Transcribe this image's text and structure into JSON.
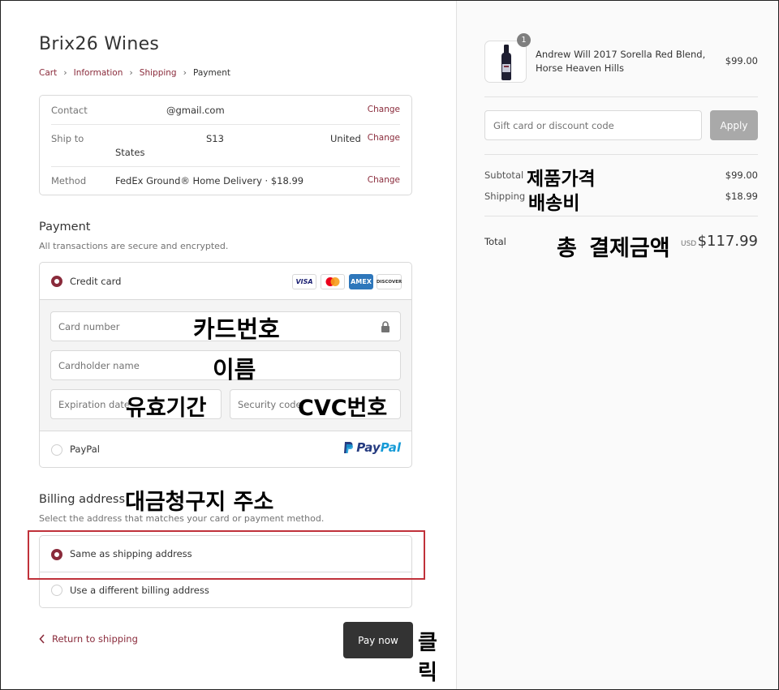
{
  "store": {
    "name": "Brix26 Wines"
  },
  "breadcrumb": {
    "cart": "Cart",
    "information": "Information",
    "shipping": "Shipping",
    "payment": "Payment",
    "separator": "›"
  },
  "review": {
    "contact_label": "Contact",
    "contact_value": "@gmail.com",
    "ship_label": "Ship to",
    "ship_value_mid": "S13",
    "ship_value_country": "United",
    "ship_value_states": "States",
    "method_label": "Method",
    "method_value": "FedEx Ground® Home Delivery · $18.99",
    "change_label": "Change"
  },
  "payment": {
    "title": "Payment",
    "subtitle": "All transactions are secure and encrypted.",
    "credit_card_label": "Credit card",
    "card_logos": {
      "visa": "VISA",
      "amex": "AMEX",
      "discover": "DISCOVER"
    },
    "card_number_placeholder": "Card number",
    "cardholder_placeholder": "Cardholder name",
    "expiration_placeholder": "Expiration date",
    "security_placeholder": "Security code",
    "paypal_label": "PayPal",
    "paypal_logo_pay": "Pay",
    "paypal_logo_pal": "Pal"
  },
  "billing": {
    "title": "Billing address",
    "subtitle": "Select the address that matches your card or payment method.",
    "same_label": "Same as shipping address",
    "different_label": "Use a different billing address"
  },
  "actions": {
    "return_label": "Return to shipping",
    "pay_now": "Pay now"
  },
  "annotations": {
    "card_number": "카드번호",
    "name": "이름",
    "expiry": "유효기간",
    "cvc": "CVC번호",
    "billing": "대금청구지 주소",
    "click": "클릭",
    "product_price": "제품가격",
    "shipping_fee": "배송비",
    "total": "총 결제금액"
  },
  "summary": {
    "qty": "1",
    "product_name": "Andrew Will 2017 Sorella Red Blend, Horse Heaven Hills",
    "product_price": "$99.00",
    "gift_placeholder": "Gift card or discount code",
    "apply_label": "Apply",
    "subtotal_label": "Subtotal",
    "subtotal_value": "$99.00",
    "shipping_label": "Shipping",
    "shipping_value": "$18.99",
    "total_label": "Total",
    "currency": "USD",
    "total_value": "$117.99"
  },
  "colors": {
    "accent": "#8a2b3b",
    "highlight": "#c0313a",
    "button_dark": "#333333",
    "paypal_dark": "#253b80",
    "paypal_light": "#179bd7"
  }
}
